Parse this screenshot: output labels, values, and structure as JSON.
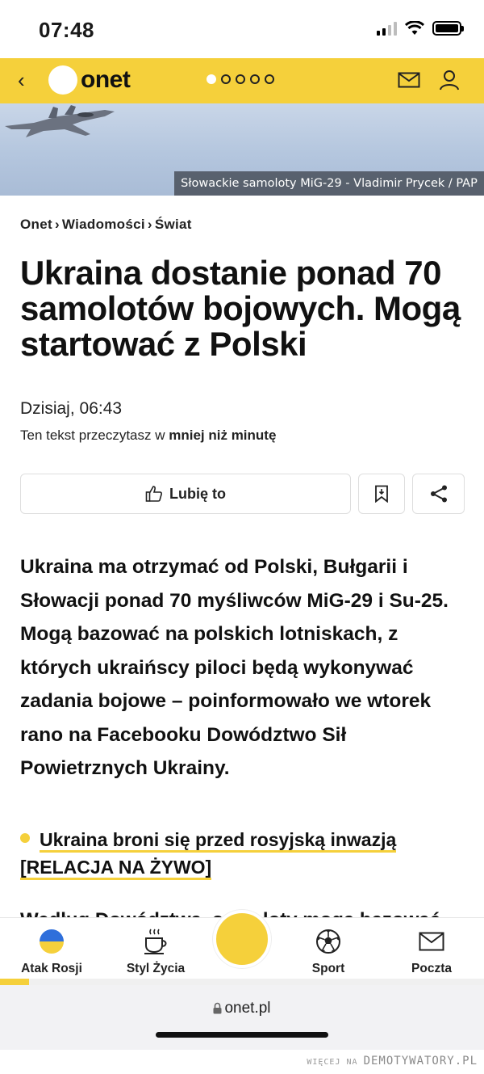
{
  "status_bar": {
    "time": "07:48"
  },
  "header": {
    "logo_text": "onet",
    "page_dots_total": 5,
    "page_dots_active": 1
  },
  "hero": {
    "caption": "Słowackie samoloty MiG-29 - Vladimir Prycek / PAP"
  },
  "breadcrumb": {
    "items": [
      "Onet",
      "Wiadomości",
      "Świat"
    ],
    "separator": "›"
  },
  "article": {
    "title": "Ukraina dostanie ponad 70 samolotów bojowych. Mogą startować z Polski",
    "date": "Dzisiaj, 06:43",
    "read_time_prefix": "Ten tekst przeczytasz w ",
    "read_time_value": "mniej niż minutę",
    "lead": "Ukraina ma otrzymać od Polski, Bułgarii i Słowacji ponad 70 myśliwców MiG-29 i Su-25. Mogą bazować na polskich lotniskach, z których ukraińscy piloci będą wykonywać zadania bojowe – poinformowało we wtorek rano na Facebooku Dowództwo Sił Powietrznych Ukrainy.",
    "related_link": "Ukraina broni się przed rosyjską inwazją [RELACJA NA ŻYWO]",
    "next_text_peek": "Według Dowództwa, samoloty mogą bazować"
  },
  "actions": {
    "like_label": "Lubię to"
  },
  "bottom_nav": {
    "items": [
      {
        "label": "Atak Rosji",
        "icon": "ukraine-flag-icon"
      },
      {
        "label": "Styl Życia",
        "icon": "coffee-cup-icon"
      },
      {
        "label": "Sport",
        "icon": "soccer-ball-icon"
      },
      {
        "label": "Poczta",
        "icon": "mail-icon"
      }
    ],
    "progress_fraction": 0.06
  },
  "browser": {
    "url": "onet.pl"
  },
  "watermark": {
    "prefix": "WIĘCEJ NA ",
    "site": "DEMOTYWATORY.PL"
  },
  "colors": {
    "accent": "#f5d03b",
    "text": "#111111"
  }
}
